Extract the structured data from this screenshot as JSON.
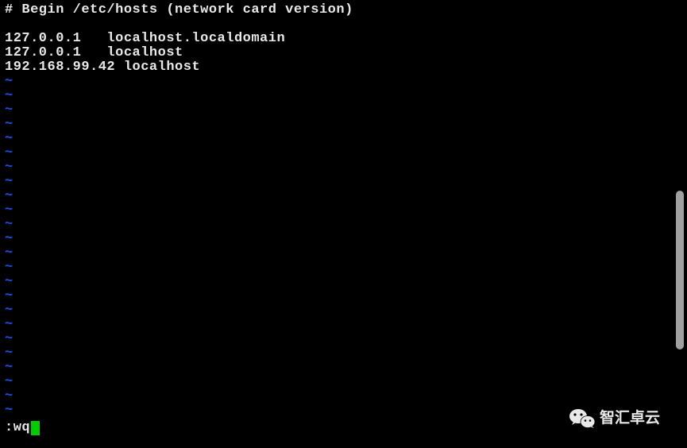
{
  "file": {
    "lines": [
      "# Begin /etc/hosts (network card version)",
      "",
      "127.0.0.1   localhost.localdomain",
      "127.0.0.1   localhost",
      "192.168.99.42 localhost"
    ]
  },
  "tilde_count": 24,
  "tilde_char": "~",
  "command": ":wq",
  "watermark": {
    "text": "智汇卓云",
    "icon": "wechat-icon"
  }
}
